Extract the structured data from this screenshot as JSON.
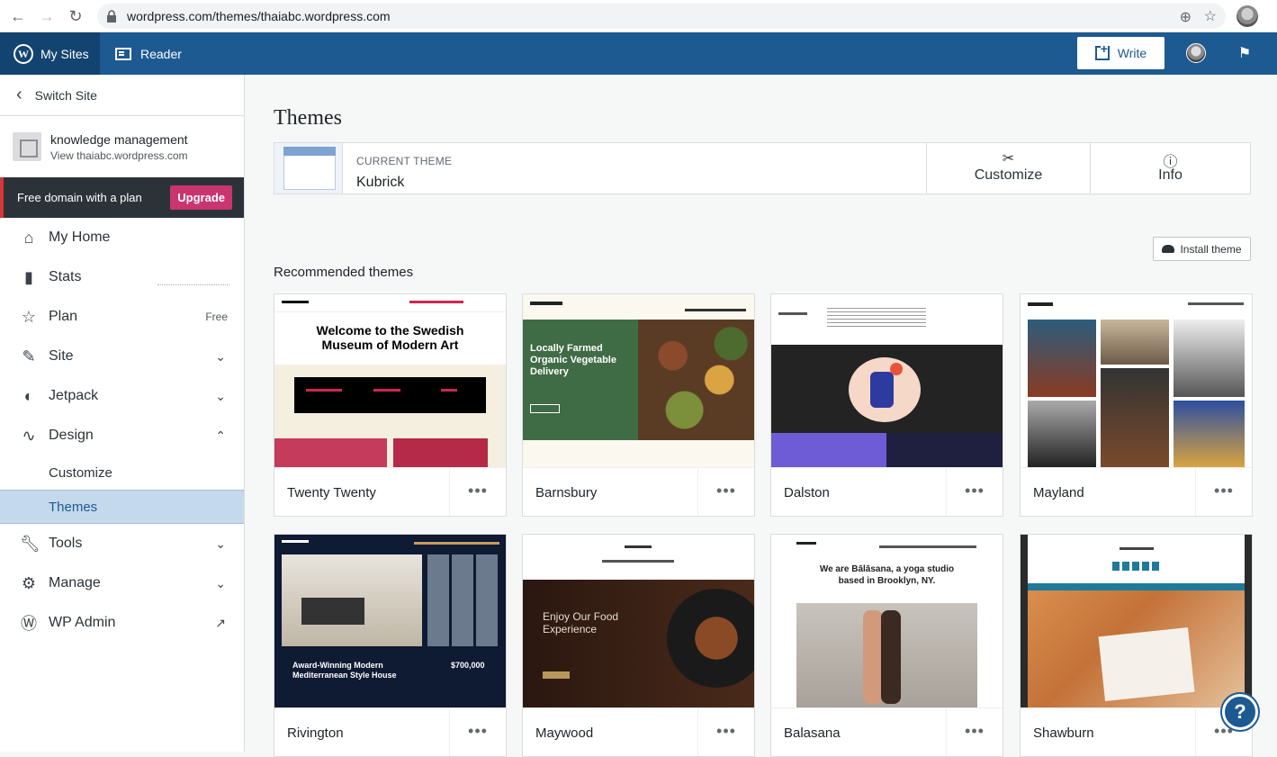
{
  "browser": {
    "url": "wordpress.com/themes/thaiabc.wordpress.com"
  },
  "masterbar": {
    "my_sites": "My Sites",
    "reader": "Reader",
    "write": "Write"
  },
  "sidebar": {
    "switch_site": "Switch Site",
    "site_name": "knowledge management",
    "site_url": "View thaiabc.wordpress.com",
    "upgrade_text": "Free domain with a plan",
    "upgrade_button": "Upgrade",
    "items": [
      {
        "label": "My Home",
        "icon": "home-icon"
      },
      {
        "label": "Stats",
        "icon": "stats-icon"
      },
      {
        "label": "Plan",
        "icon": "star-icon",
        "badge": "Free"
      },
      {
        "label": "Site",
        "icon": "pencil-icon"
      },
      {
        "label": "Jetpack",
        "icon": "jetpack-icon"
      },
      {
        "label": "Design",
        "icon": "design-icon"
      },
      {
        "label": "Tools",
        "icon": "wrench-icon"
      },
      {
        "label": "Manage",
        "icon": "gear-icon"
      },
      {
        "label": "WP Admin",
        "icon": "wordpress-icon"
      }
    ],
    "design_sub": [
      "Customize",
      "Themes"
    ]
  },
  "main": {
    "title": "Themes",
    "current_label": "Current Theme",
    "current_name": "Kubrick",
    "customize": "Customize",
    "info": "Info",
    "install_theme": "Install theme",
    "recommended": "Recommended themes",
    "themes": [
      {
        "name": "Twenty Twenty",
        "headline": "Welcome to the Swedish Museum of Modern Art"
      },
      {
        "name": "Barnsbury",
        "headline": "Locally Farmed Organic Vegetable Delivery"
      },
      {
        "name": "Dalston"
      },
      {
        "name": "Mayland"
      },
      {
        "name": "Rivington",
        "headline": "Award-Winning Modern Mediterranean Style House",
        "price": "$700,000"
      },
      {
        "name": "Maywood",
        "headline": "Enjoy Our Food Experience"
      },
      {
        "name": "Balasana",
        "headline": "We are Bālāsana, a yoga studio based in Brooklyn, NY."
      },
      {
        "name": "Shawburn"
      }
    ],
    "more": "•••"
  },
  "colors": {
    "masterbar": "#1d5a91",
    "selected": "#c5d9ed",
    "upgrade": "#c9356e"
  }
}
